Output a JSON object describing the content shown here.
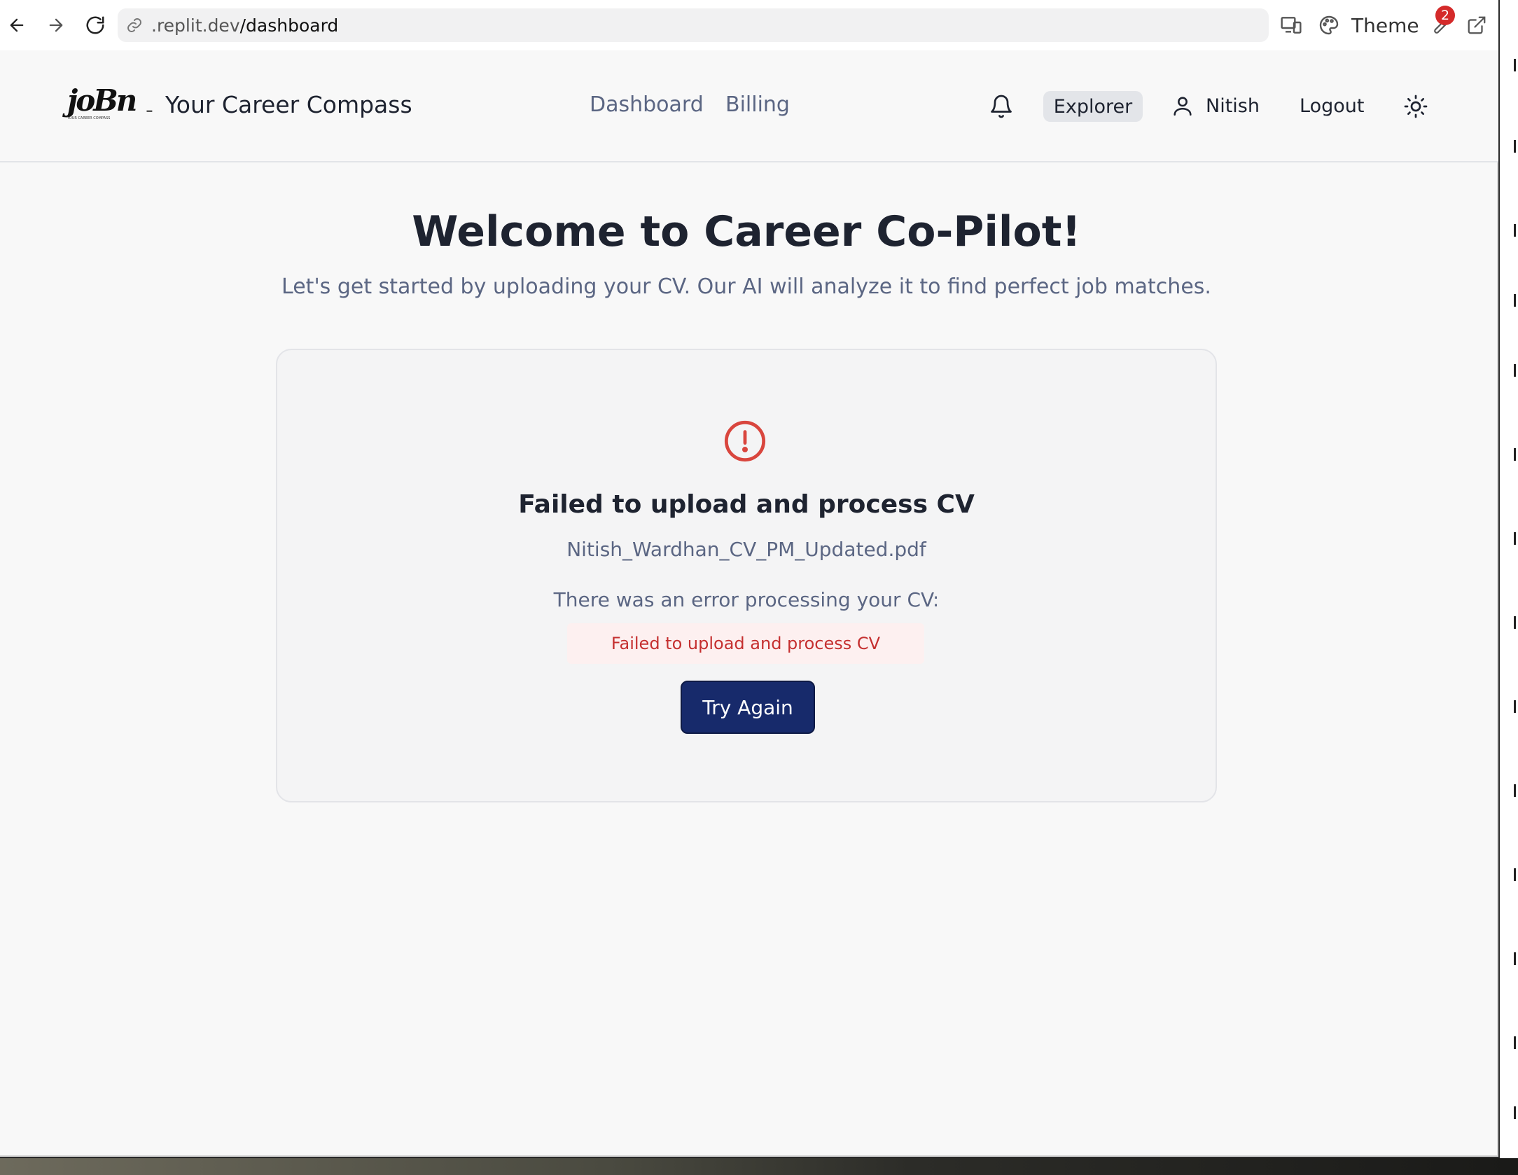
{
  "browser": {
    "url_domain": ".replit.dev",
    "url_path": "/dashboard",
    "theme_label": "Theme",
    "notification_count": "2"
  },
  "header": {
    "brand_dash": "-",
    "brand_title": "Your Career Compass",
    "logo_text": "joBn",
    "logo_sub": "YOUR CAREER COMPASS",
    "nav": [
      "Dashboard",
      "Billing"
    ],
    "plan_badge": "Explorer",
    "user_name": "Nitish",
    "logout_label": "Logout"
  },
  "main": {
    "title": "Welcome to Career Co-Pilot!",
    "subtitle": "Let's get started by uploading your CV. Our AI will analyze it to find perfect job matches."
  },
  "upload_card": {
    "status_icon": "alert-circle-icon",
    "title": "Failed to upload and process CV",
    "file_name": "Nitish_Wardhan_CV_PM_Updated.pdf",
    "error_intro": "There was an error processing your CV:",
    "error_message": "Failed to upload and process CV",
    "retry_label": "Try Again"
  },
  "colors": {
    "primary": "#172a6b",
    "error": "#c53030",
    "error_bg": "#fdf0f0",
    "muted_text": "#5b6683"
  }
}
